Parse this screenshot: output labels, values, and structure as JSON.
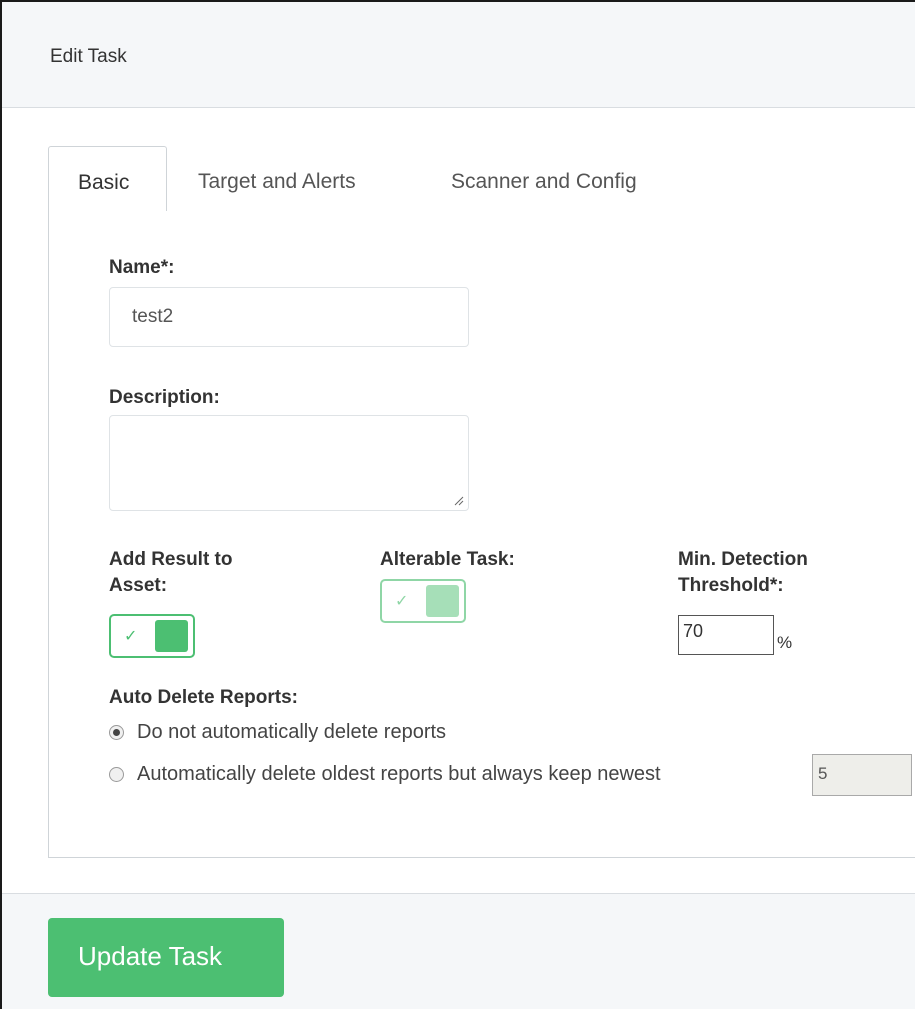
{
  "panel": {
    "title": "Edit Task"
  },
  "tabs": [
    {
      "label": "Basic",
      "active": true
    },
    {
      "label": "Target and Alerts",
      "active": false
    },
    {
      "label": "Scanner and Config",
      "active": false
    }
  ],
  "form": {
    "name": {
      "label": "Name*:",
      "value": "test2"
    },
    "description": {
      "label": "Description:",
      "value": ""
    },
    "add_result_to_asset": {
      "label_line1": "Add Result to",
      "label_line2": "Asset:",
      "checked": true,
      "check_glyph": "✓"
    },
    "alterable_task": {
      "label": "Alterable Task:",
      "checked": true,
      "enabled": false,
      "check_glyph": "✓"
    },
    "min_detection_threshold": {
      "label_line1": "Min. Detection",
      "label_line2": "Threshold*:",
      "value": "70",
      "unit": "%"
    },
    "auto_delete_reports": {
      "label": "Auto Delete Reports:",
      "options": [
        {
          "label": "Do not automatically delete reports",
          "selected": true
        },
        {
          "label": "Automatically delete oldest reports but always keep newest",
          "selected": false
        }
      ],
      "keep_count": "5"
    }
  },
  "footer": {
    "submit_label": "Update Task"
  },
  "colors": {
    "accent": "#4cbf72",
    "header_bg": "#f5f7f9",
    "border": "#cfd4d8"
  }
}
